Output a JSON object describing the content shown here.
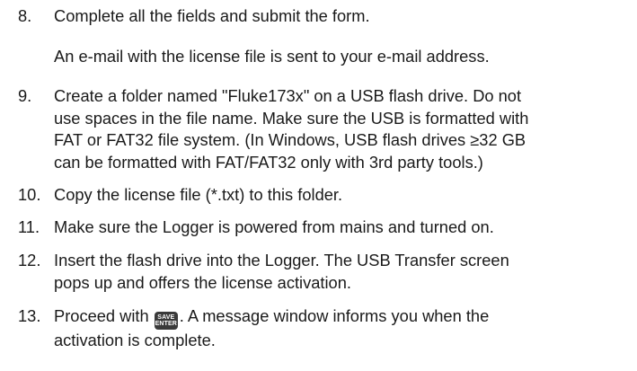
{
  "steps": [
    {
      "number": "8.",
      "lines": [
        "Complete all the fields and submit the form."
      ],
      "note": "An e-mail with the license file is sent to your e-mail address."
    },
    {
      "number": "9.",
      "lines": [
        "Create a folder named \"Fluke173x\" on a USB flash drive. Do not",
        "use spaces in the file name. Make sure the USB is formatted with",
        "FAT or FAT32 file system. (In Windows, USB flash drives ≥32 GB",
        "can be formatted with FAT/FAT32 only with 3rd party tools.)"
      ]
    },
    {
      "number": "10.",
      "lines": [
        "Copy the license file (*.txt) to this folder."
      ]
    },
    {
      "number": "11.",
      "lines": [
        "Make sure the Logger is powered from mains and turned on."
      ]
    },
    {
      "number": "12.",
      "lines": [
        "Insert the flash drive into the Logger. The USB Transfer screen",
        "pops up and offers the license activation."
      ]
    },
    {
      "number": "13.",
      "line1_before": "Proceed with",
      "line1_after": ". A message window informs you when the",
      "line2": "activation is complete.",
      "key": {
        "top": "SAVE",
        "bottom": "ENTER",
        "icon": "save-enter-key-icon"
      }
    }
  ]
}
